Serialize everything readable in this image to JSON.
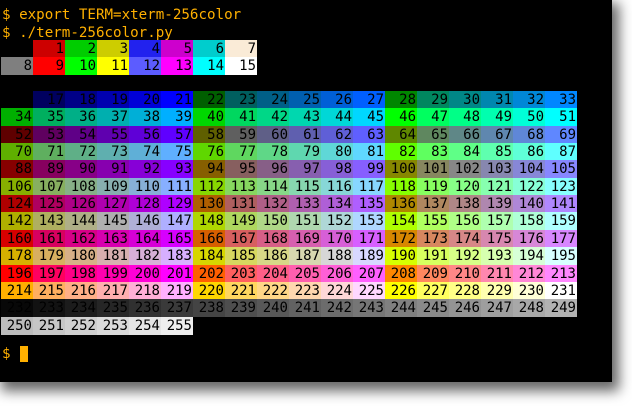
{
  "terminal": {
    "command_1": "$ export TERM=xterm-256color",
    "command_2": "$ ./term-256color.py",
    "prompt": "$",
    "prompt_color": "#ffb000",
    "background": "#000000",
    "text_color": "#000000"
  },
  "system_colors": [
    {
      "label": "",
      "color": "#000000"
    },
    {
      "label": "1",
      "color": "#cd0000"
    },
    {
      "label": "2",
      "color": "#00cd00"
    },
    {
      "label": "3",
      "color": "#cdcd00"
    },
    {
      "label": "4",
      "color": "#2222ee"
    },
    {
      "label": "5",
      "color": "#cd00cd"
    },
    {
      "label": "6",
      "color": "#00cdcd"
    },
    {
      "label": "7",
      "color": "#faebd7"
    },
    {
      "label": "8",
      "color": "#7f7f7f"
    },
    {
      "label": "9",
      "color": "#ff0000"
    },
    {
      "label": "10",
      "color": "#00ff00"
    },
    {
      "label": "11",
      "color": "#ffff00"
    },
    {
      "label": "12",
      "color": "#5c5cff"
    },
    {
      "label": "13",
      "color": "#ff00ff"
    },
    {
      "label": "14",
      "color": "#00ffff"
    },
    {
      "label": "15",
      "color": "#ffffff"
    }
  ],
  "cube_levels": [
    0,
    95,
    135,
    175,
    215,
    255
  ],
  "cube_index_start": 16,
  "cube_index_end": 231,
  "gray_index_start": 232,
  "gray_index_end": 255,
  "gray_base": 8,
  "gray_step": 10
}
